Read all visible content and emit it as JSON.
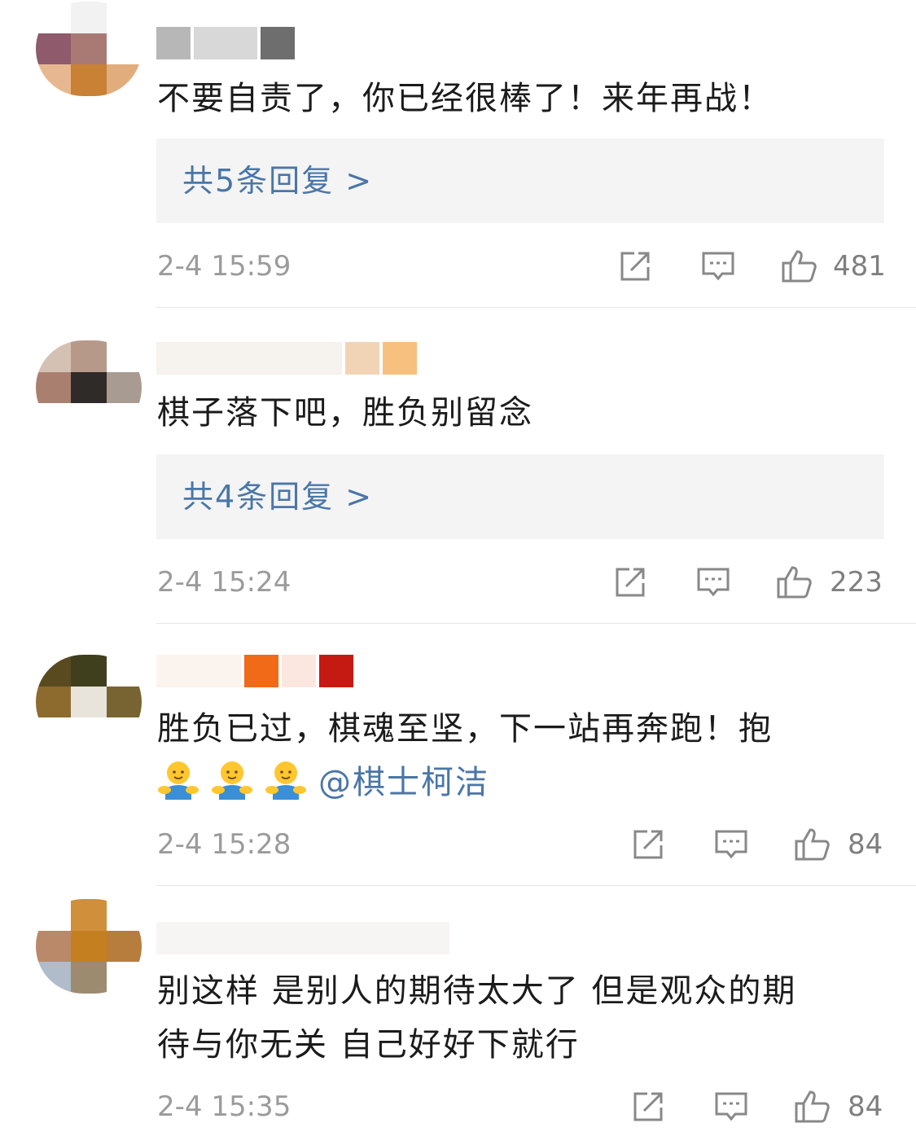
{
  "comments": [
    {
      "text": "不要自责了，你已经很棒了！来年再战！",
      "replies_label": "共5条回复 >",
      "time": "2-4 15:59",
      "likes": "481",
      "icons": {
        "share": "share-icon",
        "comment": "comment-icon",
        "like": "thumbs-up-icon"
      }
    },
    {
      "text": "棋子落下吧，胜负别留念",
      "replies_label": "共4条回复 >",
      "time": "2-4 15:24",
      "likes": "223",
      "icons": {
        "share": "share-icon",
        "comment": "comment-icon",
        "like": "thumbs-up-icon"
      }
    },
    {
      "text": "胜负已过，棋魂至坚，下一站再奔跑！抱",
      "mention": "@棋士柯洁",
      "emoji": "hug-emoji",
      "time": "2-4 15:28",
      "likes": "84",
      "icons": {
        "share": "share-icon",
        "comment": "comment-icon",
        "like": "thumbs-up-icon"
      }
    },
    {
      "text_line1": "别这样 是别人的期待太大了 但是观众的期",
      "text_line2": "待与你无关 自己好好下就行",
      "time": "2-4 15:35",
      "likes": "84",
      "icons": {
        "share": "share-icon",
        "comment": "comment-icon",
        "like": "thumbs-up-icon"
      }
    }
  ],
  "colors": {
    "link": "#4a76a8",
    "text": "#1b1b1b",
    "meta": "#9b9b9b",
    "reply_bg": "#f4f4f4",
    "divider": "#e6e6e6"
  }
}
